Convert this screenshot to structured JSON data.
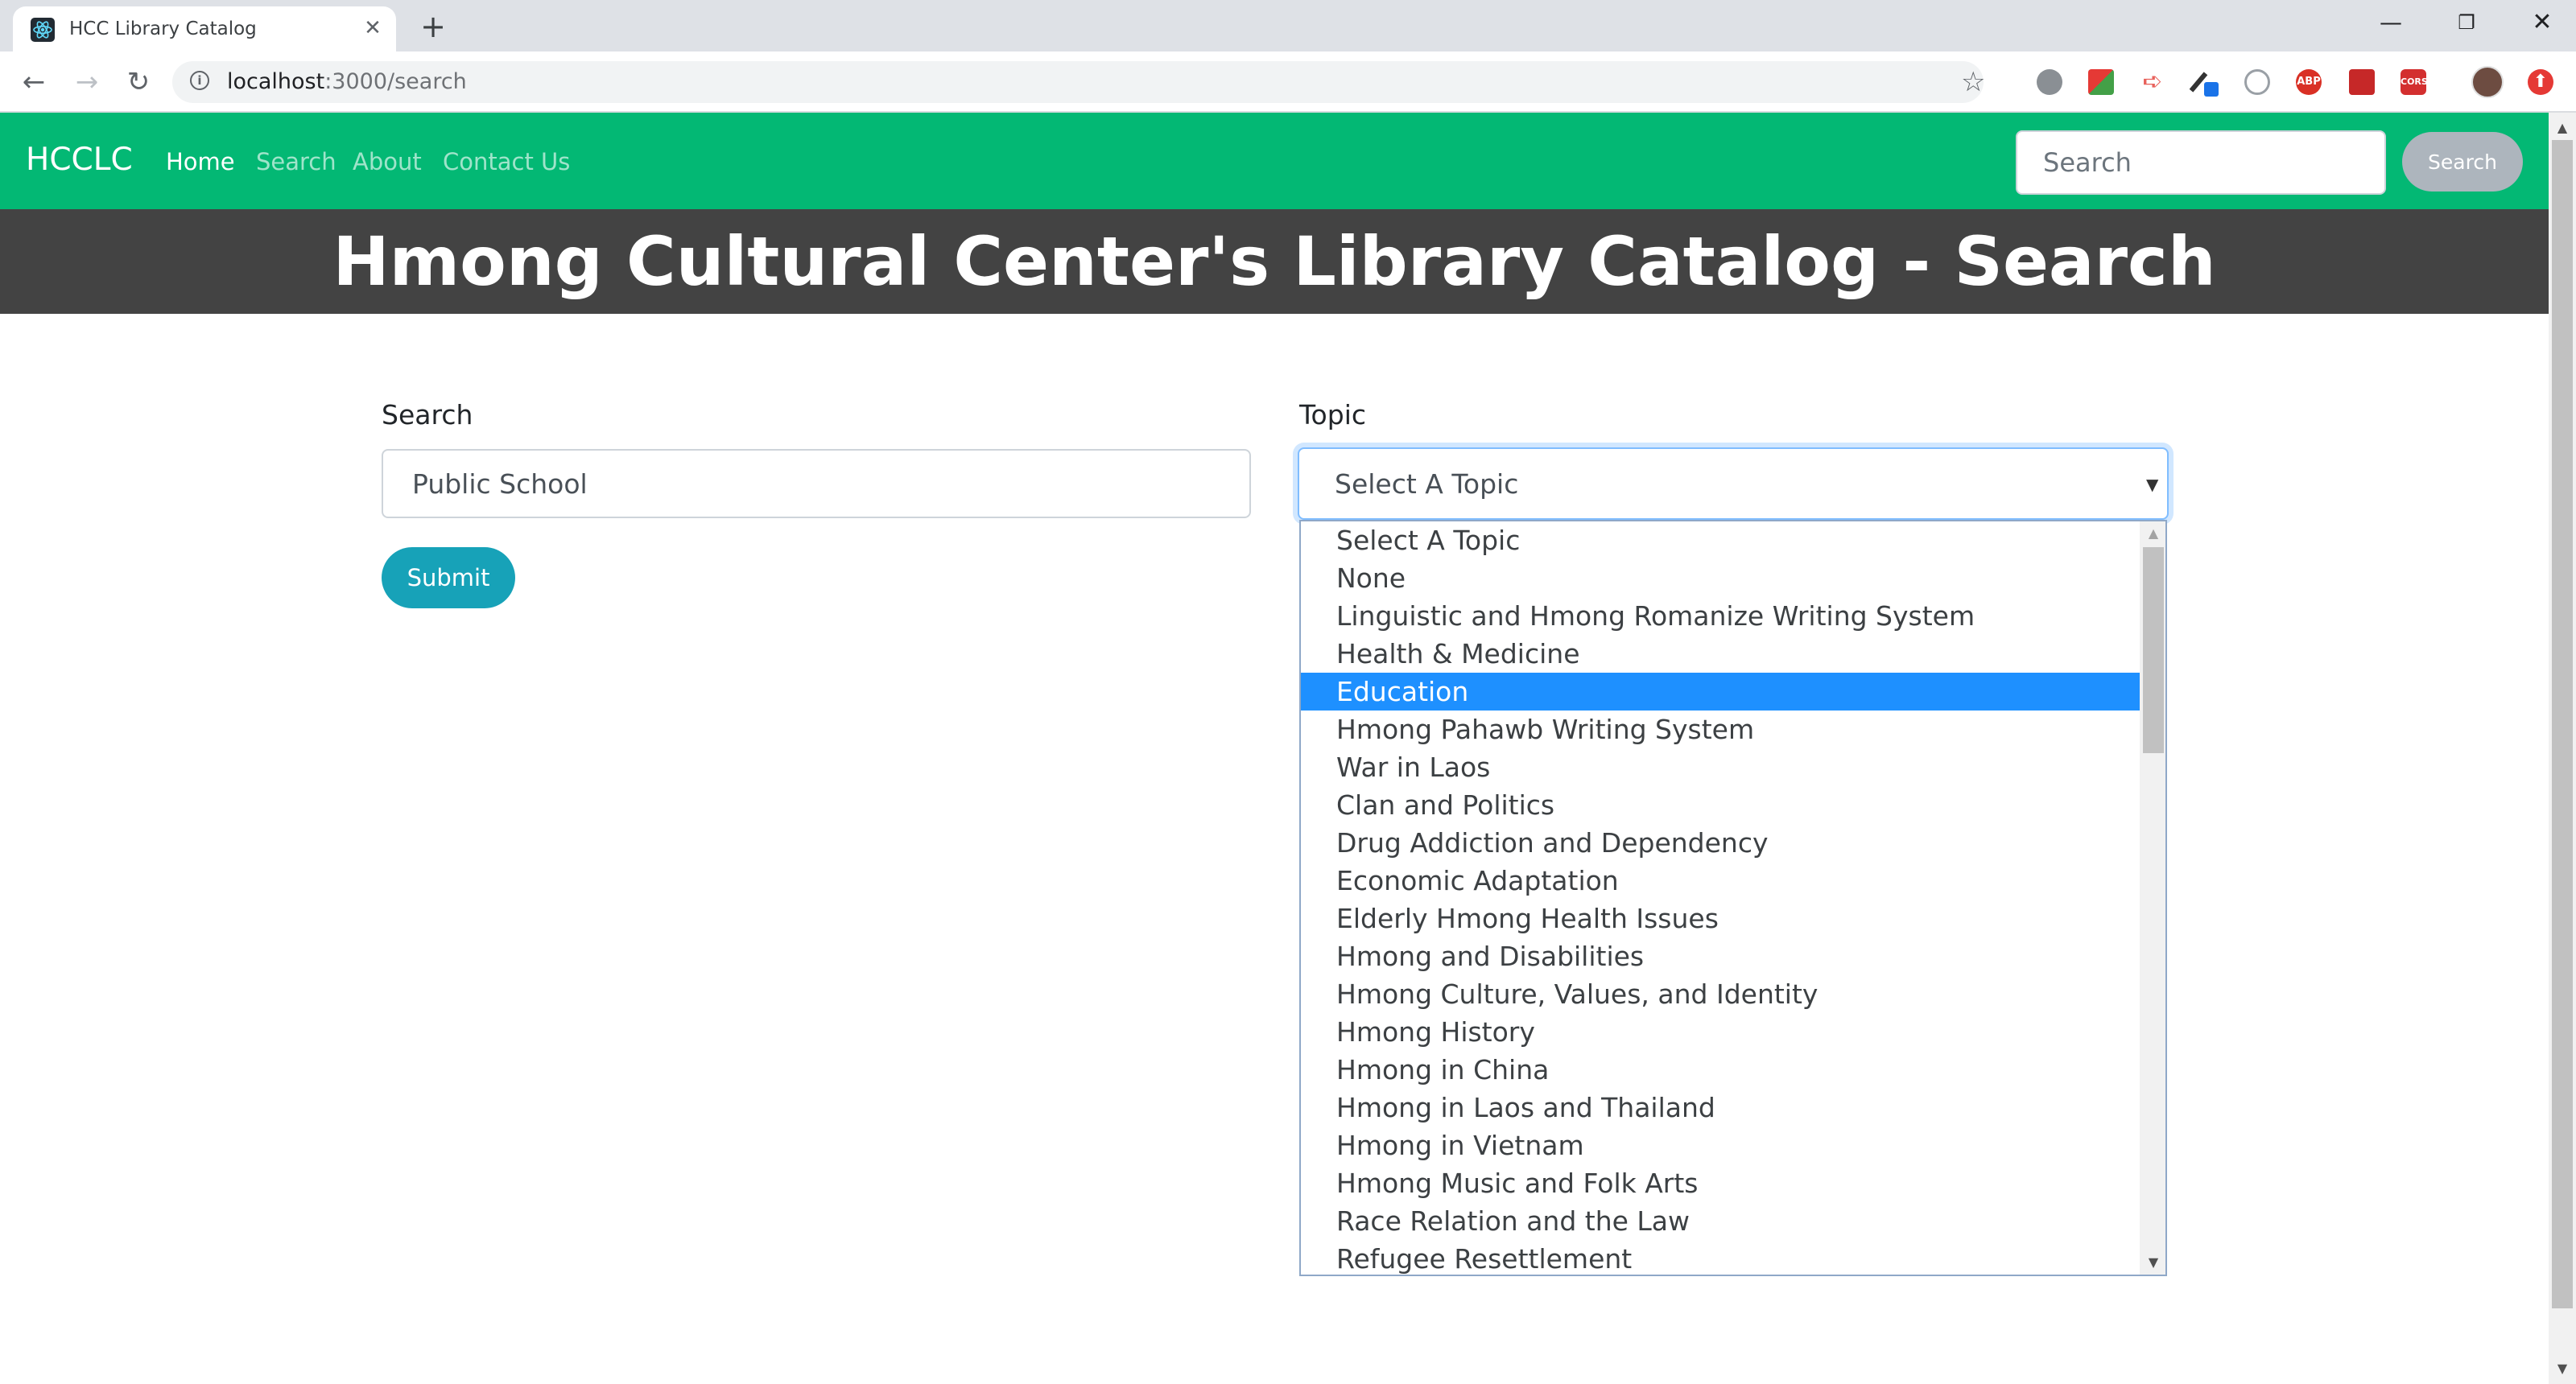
{
  "browser": {
    "tab_title": "HCC Library Catalog",
    "tab_close": "✕",
    "new_tab": "+",
    "url_host": "localhost",
    "url_path": ":3000/search",
    "icons": {
      "back": "←",
      "forward": "→",
      "reload": "↻",
      "info": "i",
      "star": "☆",
      "minimize": "—",
      "restore": "❐",
      "close": "✕"
    },
    "extensions": {
      "abp": "ABP",
      "cors": "CORS",
      "update": "⬆",
      "share": "➪"
    }
  },
  "navbar": {
    "brand": "HCCLC",
    "links": [
      "Home",
      "Search",
      "About",
      "Contact Us"
    ],
    "search_placeholder": "Search",
    "search_button": "Search",
    "color": "#03b874"
  },
  "header": {
    "title": "Hmong Cultural Center's Library Catalog - Search",
    "background": "#434343"
  },
  "form": {
    "search_label": "Search",
    "search_value": "Public School",
    "submit_label": "Submit",
    "topic_label": "Topic",
    "topic_selected": "Select A Topic",
    "topic_arrow": "▼",
    "topic_options": [
      "Select A Topic",
      "None",
      "Linguistic and Hmong Romanize Writing System",
      "Health & Medicine",
      "Education",
      "Hmong Pahawb Writing System",
      "War in Laos",
      "Clan and Politics",
      "Drug Addiction and Dependency",
      "Economic Adaptation",
      "Elderly Hmong Health Issues",
      "Hmong and Disabilities",
      "Hmong Culture, Values, and Identity",
      "Hmong History",
      "Hmong in China",
      "Hmong in Laos and Thailand",
      "Hmong in Vietnam",
      "Hmong Music and Folk Arts",
      "Race Relation and the Law",
      "Refugee Resettlement"
    ],
    "highlighted_option": "Education",
    "highlight_color": "#1e90ff",
    "submit_color": "#17a2b8"
  },
  "scrollbar": {
    "up_arrow": "▲",
    "down_arrow": "▼"
  }
}
